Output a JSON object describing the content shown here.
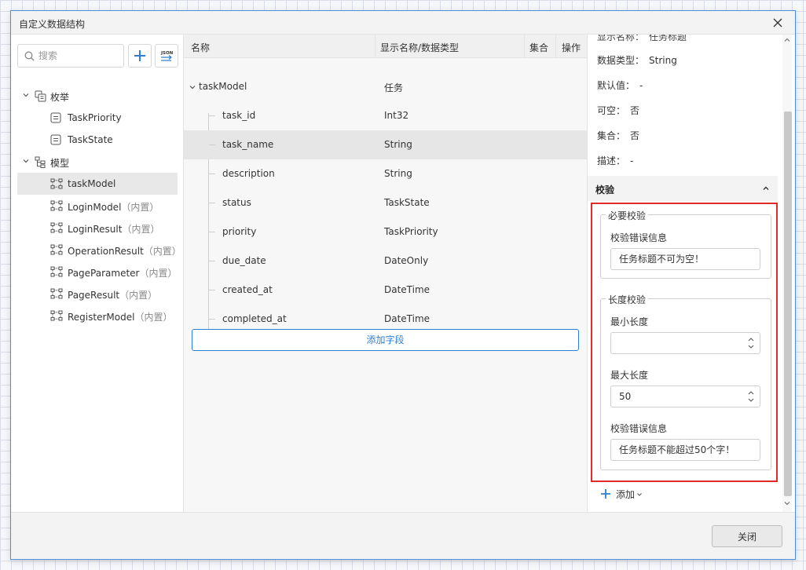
{
  "dialog": {
    "title": "自定义数据结构",
    "close_label": "关闭"
  },
  "sidebar": {
    "search_placeholder": "搜索",
    "json_label": "JSON",
    "enum_group": "枚举",
    "enum_items": [
      "TaskPriority",
      "TaskState"
    ],
    "model_group": "模型",
    "models": [
      {
        "name": "taskModel",
        "tag": ""
      },
      {
        "name": "LoginModel",
        "tag": "（内置）"
      },
      {
        "name": "LoginResult",
        "tag": "（内置）"
      },
      {
        "name": "OperationResult",
        "tag": "（内置）"
      },
      {
        "name": "PageParameter",
        "tag": "（内置）"
      },
      {
        "name": "PageResult",
        "tag": "（内置）"
      },
      {
        "name": "RegisterModel",
        "tag": "（内置）"
      }
    ]
  },
  "table": {
    "columns": [
      "名称",
      "显示名称/数据类型",
      "集合",
      "操作"
    ],
    "root": {
      "name": "taskModel",
      "type": "任务"
    },
    "rows": [
      {
        "name": "task_id",
        "type": "Int32"
      },
      {
        "name": "task_name",
        "type": "String"
      },
      {
        "name": "description",
        "type": "String"
      },
      {
        "name": "status",
        "type": "TaskState"
      },
      {
        "name": "priority",
        "type": "TaskPriority"
      },
      {
        "name": "due_date",
        "type": "DateOnly"
      },
      {
        "name": "created_at",
        "type": "DateTime"
      },
      {
        "name": "completed_at",
        "type": "DateTime"
      }
    ],
    "add_field_label": "添加字段"
  },
  "props": {
    "display_name_label": "显示名称：",
    "display_name_value": "任务标题",
    "data_type_label": "数据类型：",
    "data_type_value": "String",
    "default_label": "默认值：",
    "default_value": "-",
    "nullable_label": "可空：",
    "nullable_value": "否",
    "collection_label": "集合：",
    "collection_value": "否",
    "desc_label": "描述：",
    "desc_value": "-"
  },
  "validation": {
    "section_title": "校验",
    "required": {
      "title": "必要校验",
      "msg_label": "校验错误信息",
      "msg_value": "任务标题不可为空！"
    },
    "length": {
      "title": "长度校验",
      "min_label": "最小长度",
      "min_value": "",
      "max_label": "最大长度",
      "max_value": "50",
      "msg_label": "校验错误信息",
      "msg_value": "任务标题不能超过50个字！"
    },
    "add_label": "添加"
  }
}
